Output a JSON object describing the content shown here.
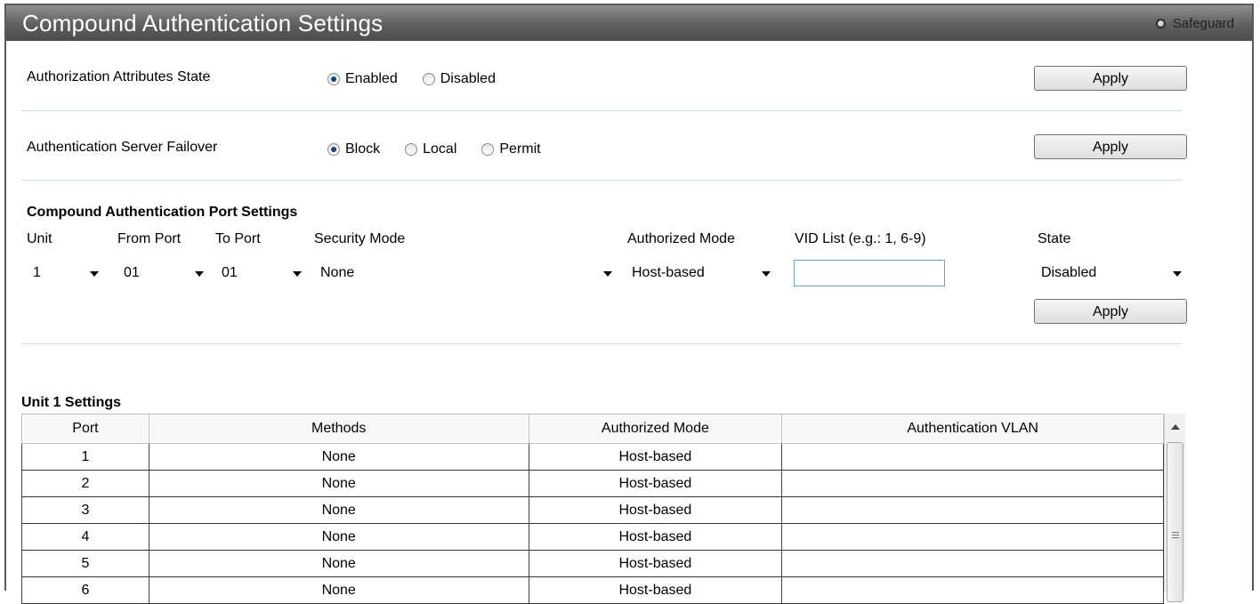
{
  "header": {
    "title": "Compound Authentication Settings",
    "safeguard_label": "Safeguard"
  },
  "authorization_attributes": {
    "label": "Authorization Attributes State",
    "options": [
      "Enabled",
      "Disabled"
    ],
    "selected": "Enabled",
    "apply_label": "Apply"
  },
  "server_failover": {
    "label": "Authentication Server Failover",
    "options": [
      "Block",
      "Local",
      "Permit"
    ],
    "selected": "Block",
    "apply_label": "Apply"
  },
  "port_settings": {
    "heading": "Compound Authentication Port Settings",
    "unit_label": "Unit",
    "from_port_label": "From Port",
    "to_port_label": "To Port",
    "security_mode_label": "Security Mode",
    "authorized_mode_label": "Authorized Mode",
    "vid_list_label": "VID List (e.g.: 1, 6-9)",
    "state_label": "State",
    "unit_value": "1",
    "from_port_value": "01",
    "to_port_value": "01",
    "security_mode_value": "None",
    "authorized_mode_value": "Host-based",
    "vid_list_value": "",
    "state_value": "Disabled",
    "apply_label": "Apply"
  },
  "unit_settings": {
    "heading": "Unit 1 Settings",
    "columns": [
      "Port",
      "Methods",
      "Authorized Mode",
      "Authentication VLAN"
    ],
    "rows": [
      {
        "port": "1",
        "methods": "None",
        "mode": "Host-based",
        "vlan": ""
      },
      {
        "port": "2",
        "methods": "None",
        "mode": "Host-based",
        "vlan": ""
      },
      {
        "port": "3",
        "methods": "None",
        "mode": "Host-based",
        "vlan": ""
      },
      {
        "port": "4",
        "methods": "None",
        "mode": "Host-based",
        "vlan": ""
      },
      {
        "port": "5",
        "methods": "None",
        "mode": "Host-based",
        "vlan": ""
      },
      {
        "port": "6",
        "methods": "None",
        "mode": "Host-based",
        "vlan": ""
      }
    ]
  }
}
